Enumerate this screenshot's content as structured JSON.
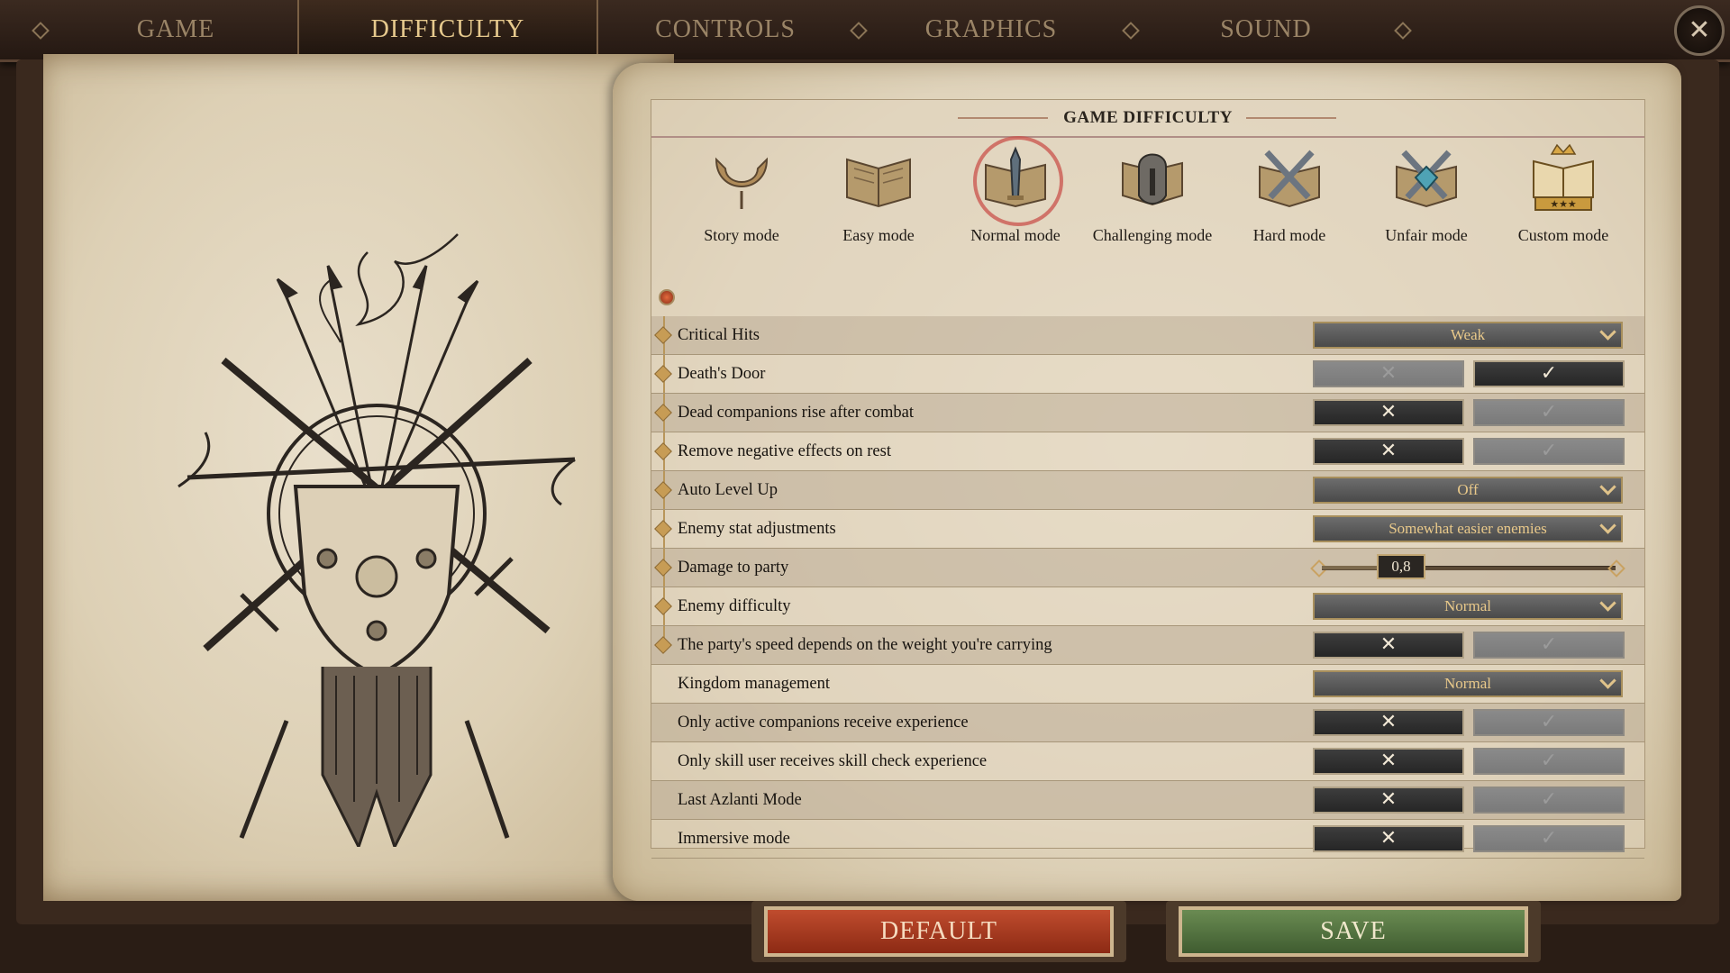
{
  "tabs": [
    {
      "label": "GAME",
      "active": false
    },
    {
      "label": "DIFFICULTY",
      "active": true
    },
    {
      "label": "CONTROLS",
      "active": false
    },
    {
      "label": "GRAPHICS",
      "active": false
    },
    {
      "label": "SOUND",
      "active": false
    }
  ],
  "close_icon": "close-icon",
  "panel": {
    "title": "GAME DIFFICULTY"
  },
  "modes": [
    {
      "label": "Story mode",
      "icon": "story-mode-icon",
      "selected": false
    },
    {
      "label": "Easy mode",
      "icon": "easy-mode-icon",
      "selected": false
    },
    {
      "label": "Normal mode",
      "icon": "normal-mode-icon",
      "selected": true
    },
    {
      "label": "Challenging mode",
      "icon": "challenging-mode-icon",
      "selected": false
    },
    {
      "label": "Hard mode",
      "icon": "hard-mode-icon",
      "selected": false
    },
    {
      "label": "Unfair mode",
      "icon": "unfair-mode-icon",
      "selected": false
    },
    {
      "label": "Custom mode",
      "icon": "custom-mode-icon",
      "selected": false
    }
  ],
  "settings": [
    {
      "label": "Critical Hits",
      "type": "dropdown",
      "value": "Weak",
      "bullet": true
    },
    {
      "label": "Death's Door",
      "type": "toggle",
      "value": true,
      "bullet": true
    },
    {
      "label": "Dead companions rise after combat",
      "type": "toggle",
      "value": false,
      "bullet": true
    },
    {
      "label": "Remove negative effects on rest",
      "type": "toggle",
      "value": false,
      "bullet": true
    },
    {
      "label": "Auto Level Up",
      "type": "dropdown",
      "value": "Off",
      "bullet": true
    },
    {
      "label": "Enemy stat adjustments",
      "type": "dropdown",
      "value": "Somewhat easier enemies",
      "bullet": true
    },
    {
      "label": "Damage to party",
      "type": "slider",
      "value": "0,8",
      "fraction": 0.27,
      "bullet": true
    },
    {
      "label": "Enemy difficulty",
      "type": "dropdown",
      "value": "Normal",
      "bullet": true
    },
    {
      "label": "The party's speed depends on the weight you're carrying",
      "type": "toggle",
      "value": false,
      "bullet": true
    },
    {
      "label": "Kingdom management",
      "type": "dropdown",
      "value": "Normal",
      "bullet": false
    },
    {
      "label": "Only active companions receive experience",
      "type": "toggle",
      "value": false,
      "bullet": false
    },
    {
      "label": "Only skill user receives skill check experience",
      "type": "toggle",
      "value": false,
      "bullet": false
    },
    {
      "label": "Last Azlanti Mode",
      "type": "toggle",
      "value": false,
      "bullet": false
    },
    {
      "label": "Immersive mode",
      "type": "toggle",
      "value": false,
      "bullet": false
    }
  ],
  "toggle_symbols": {
    "off": "✕",
    "on": "✓"
  },
  "buttons": {
    "default_label": "DEFAULT",
    "save_label": "SAVE"
  },
  "colors": {
    "accent_gold": "#e6c98d",
    "default_button": "#b0442a",
    "save_button": "#5c7d48"
  }
}
